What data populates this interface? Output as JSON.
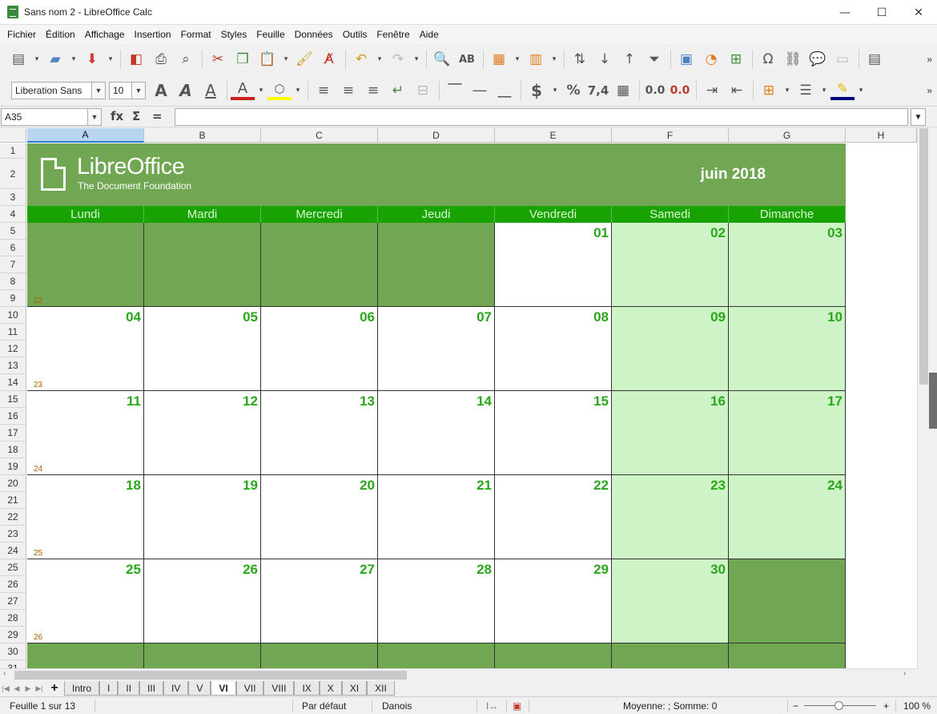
{
  "window": {
    "title": "Sans nom 2 - LibreOffice Calc",
    "minimize": "—",
    "maximize": "☐",
    "close": "✕"
  },
  "menu": [
    "Fichier",
    "Édition",
    "Affichage",
    "Insertion",
    "Format",
    "Styles",
    "Feuille",
    "Données",
    "Outils",
    "Fenêtre",
    "Aide"
  ],
  "toolbar2": {
    "font_name": "Liberation Sans",
    "font_size": "10"
  },
  "formula_bar": {
    "cell_ref": "A35",
    "formula": ""
  },
  "columns": [
    "A",
    "B",
    "C",
    "D",
    "E",
    "F",
    "G",
    "H"
  ],
  "rows": [
    "1",
    "2",
    "3",
    "4",
    "5",
    "6",
    "7",
    "8",
    "9",
    "10",
    "11",
    "12",
    "13",
    "14",
    "15",
    "16",
    "17",
    "18",
    "19",
    "20",
    "21",
    "22",
    "23",
    "24",
    "25",
    "26",
    "27",
    "28",
    "29",
    "30",
    "31"
  ],
  "banner": {
    "logo_name": "LibreOffice",
    "logo_sub": "The Document Foundation",
    "month": "juin 2018"
  },
  "weekdays": [
    "Lundi",
    "Mardi",
    "Mercredi",
    "Jeudi",
    "Vendredi",
    "Samedi",
    "Dimanche"
  ],
  "weeks": [
    {
      "week_number": "22",
      "days": [
        "",
        "",
        "",
        "",
        "01",
        "02",
        "03"
      ]
    },
    {
      "week_number": "23",
      "days": [
        "04",
        "05",
        "06",
        "07",
        "08",
        "09",
        "10"
      ]
    },
    {
      "week_number": "24",
      "days": [
        "11",
        "12",
        "13",
        "14",
        "15",
        "16",
        "17"
      ]
    },
    {
      "week_number": "25",
      "days": [
        "18",
        "19",
        "20",
        "21",
        "22",
        "23",
        "24"
      ]
    },
    {
      "week_number": "26",
      "days": [
        "25",
        "26",
        "27",
        "28",
        "29",
        "30",
        ""
      ]
    }
  ],
  "sheet_tabs": [
    "Intro",
    "I",
    "II",
    "III",
    "IV",
    "V",
    "VI",
    "VII",
    "VIII",
    "IX",
    "X",
    "XI",
    "XII"
  ],
  "active_sheet": "VI",
  "status": {
    "sheet": "Feuille 1 sur 13",
    "page_style": "Par défaut",
    "language": "Danois",
    "sum": "Moyenne: ; Somme: 0",
    "zoom": "100 %"
  },
  "colors": {
    "banner": "#71a752",
    "weekday_header": "#18a303",
    "weekend": "#cdf3c6",
    "day_number": "#2aa61a",
    "week_number": "#b15b06"
  }
}
